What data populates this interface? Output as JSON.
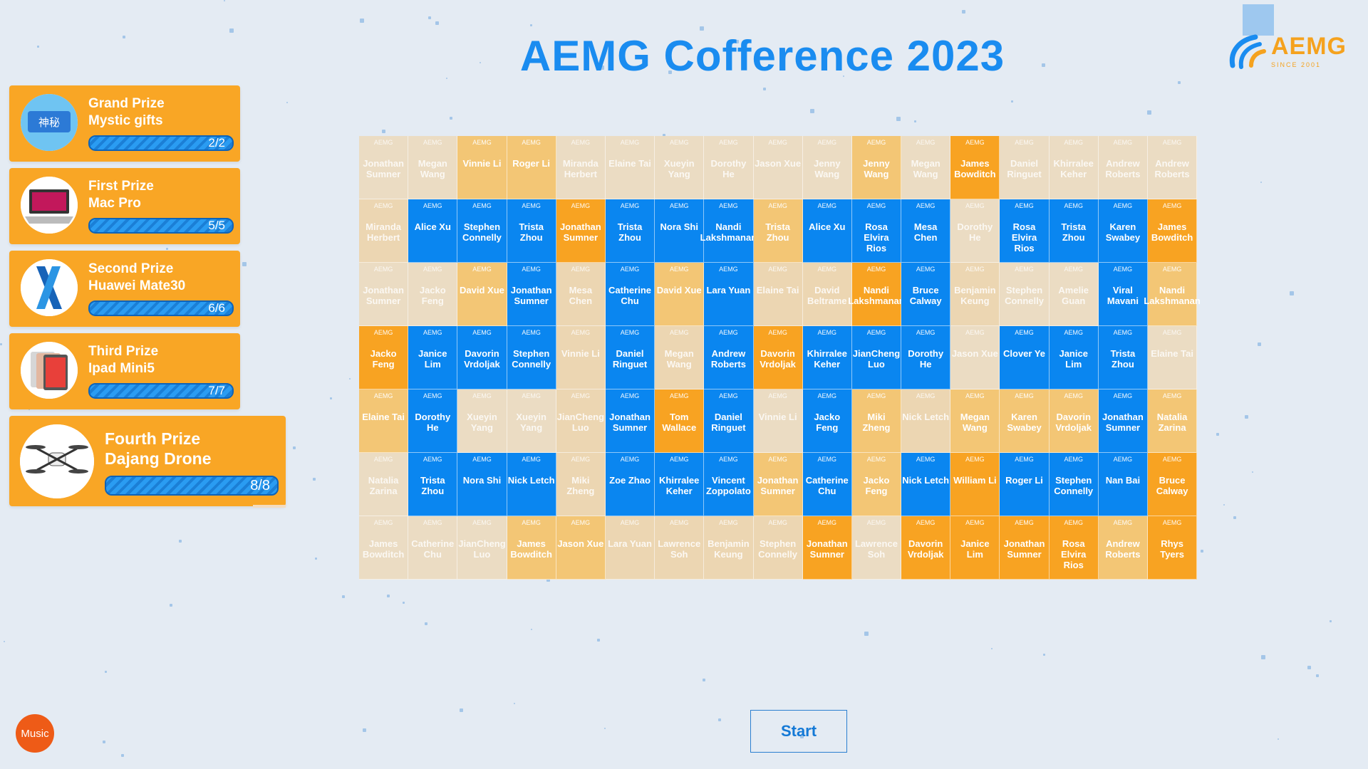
{
  "title": "AEMG Cofference 2023",
  "logo": {
    "text": "AEMG",
    "sub": "SINCE 2001"
  },
  "prizes": [
    {
      "rank": "Grand Prize",
      "item": "Mystic gifts",
      "count": "2/2",
      "icon": "mystery-gift-image"
    },
    {
      "rank": "First Prize",
      "item": "Mac Pro",
      "count": "5/5",
      "icon": "laptop-image"
    },
    {
      "rank": "Second Prize",
      "item": "Huawei Mate30",
      "count": "6/6",
      "icon": "phone-image"
    },
    {
      "rank": "Third Prize",
      "item": "Ipad Mini5",
      "count": "7/7",
      "icon": "tablet-image"
    },
    {
      "rank": "Fourth Prize",
      "item": "Dajang Drone",
      "count": "8/8",
      "icon": "drone-image"
    }
  ],
  "tag": "AEMG",
  "grid": [
    [
      [
        "Jonathan Sumner",
        "light"
      ],
      [
        "Megan Wang",
        "light"
      ],
      [
        "Vinnie Li",
        "tan"
      ],
      [
        "Roger Li",
        "tan"
      ],
      [
        "Miranda Herbert",
        "light"
      ],
      [
        "Elaine Tai",
        "light"
      ],
      [
        "Xueyin Yang",
        "light"
      ],
      [
        "Dorothy He",
        "light"
      ],
      [
        "Jason Xue",
        "light"
      ],
      [
        "Jenny Wang",
        "light"
      ],
      [
        "Jenny Wang",
        "tan"
      ],
      [
        "Megan Wang",
        "light"
      ],
      [
        "James Bowditch",
        "orange"
      ],
      [
        "Daniel Ringuet",
        "light"
      ],
      [
        "Khirralee Keher",
        "light"
      ],
      [
        "Andrew Roberts",
        "light"
      ],
      [
        "Andrew Roberts",
        "light"
      ]
    ],
    [
      [
        "Miranda Herbert",
        "beige"
      ],
      [
        "Alice Xu",
        "blue"
      ],
      [
        "Stephen Connelly",
        "blue"
      ],
      [
        "Trista Zhou",
        "blue"
      ],
      [
        "Jonathan Sumner",
        "orange"
      ],
      [
        "Trista Zhou",
        "blue"
      ],
      [
        "Nora Shi",
        "blue"
      ],
      [
        "Nandi Lakshmanan",
        "blue"
      ],
      [
        "Trista Zhou",
        "tan"
      ],
      [
        "Alice Xu",
        "blue"
      ],
      [
        "Rosa Elvira Rios",
        "blue"
      ],
      [
        "Mesa Chen",
        "blue"
      ],
      [
        "Dorothy He",
        "light"
      ],
      [
        "Rosa Elvira Rios",
        "blue"
      ],
      [
        "Trista Zhou",
        "blue"
      ],
      [
        "Karen Swabey",
        "blue"
      ],
      [
        "James Bowditch",
        "orange"
      ]
    ],
    [
      [
        "Jonathan Sumner",
        "light"
      ],
      [
        "Jacko Feng",
        "light"
      ],
      [
        "David Xue",
        "tan"
      ],
      [
        "Jonathan Sumner",
        "blue"
      ],
      [
        "Mesa Chen",
        "beige"
      ],
      [
        "Catherine Chu",
        "blue"
      ],
      [
        "David Xue",
        "tan"
      ],
      [
        "Lara Yuan",
        "blue"
      ],
      [
        "Elaine Tai",
        "beige"
      ],
      [
        "David Beltrame",
        "beige"
      ],
      [
        "Nandi Lakshmanan",
        "orange"
      ],
      [
        "Bruce Calway",
        "blue"
      ],
      [
        "Benjamin Keung",
        "beige"
      ],
      [
        "Stephen Connelly",
        "light"
      ],
      [
        "Amelie Guan",
        "light"
      ],
      [
        "Viral Mavani",
        "blue"
      ],
      [
        "Nandi Lakshmanan",
        "tan"
      ]
    ],
    [
      [
        "Jacko Feng",
        "orange"
      ],
      [
        "Janice Lim",
        "blue"
      ],
      [
        "Davorin Vrdoljak",
        "blue"
      ],
      [
        "Stephen Connelly",
        "blue"
      ],
      [
        "Vinnie Li",
        "beige"
      ],
      [
        "Daniel Ringuet",
        "blue"
      ],
      [
        "Megan Wang",
        "beige"
      ],
      [
        "Andrew Roberts",
        "blue"
      ],
      [
        "Davorin Vrdoljak",
        "orange"
      ],
      [
        "Khirralee Keher",
        "blue"
      ],
      [
        "JianCheng Luo",
        "blue"
      ],
      [
        "Dorothy He",
        "blue"
      ],
      [
        "Jason Xue",
        "light"
      ],
      [
        "Clover Ye",
        "blue"
      ],
      [
        "Janice Lim",
        "blue"
      ],
      [
        "Trista Zhou",
        "blue"
      ],
      [
        "Elaine Tai",
        "light"
      ]
    ],
    [
      [
        "Elaine Tai",
        "tan"
      ],
      [
        "Dorothy He",
        "blue"
      ],
      [
        "Xueyin Yang",
        "light"
      ],
      [
        "Xueyin Yang",
        "light"
      ],
      [
        "JianCheng Luo",
        "beige"
      ],
      [
        "Jonathan Sumner",
        "blue"
      ],
      [
        "Tom Wallace",
        "orange"
      ],
      [
        "Daniel Ringuet",
        "blue"
      ],
      [
        "Vinnie Li",
        "light"
      ],
      [
        "Jacko Feng",
        "blue"
      ],
      [
        "Miki Zheng",
        "tan"
      ],
      [
        "Nick Letch",
        "beige"
      ],
      [
        "Megan Wang",
        "tan"
      ],
      [
        "Karen Swabey",
        "tan"
      ],
      [
        "Davorin Vrdoljak",
        "tan"
      ],
      [
        "Jonathan Sumner",
        "blue"
      ],
      [
        "Natalia Zarina",
        "tan"
      ]
    ],
    [
      [
        "Natalia Zarina",
        "light"
      ],
      [
        "Trista Zhou",
        "blue"
      ],
      [
        "Nora Shi",
        "blue"
      ],
      [
        "Nick Letch",
        "blue"
      ],
      [
        "Miki Zheng",
        "beige"
      ],
      [
        "Zoe Zhao",
        "blue"
      ],
      [
        "Khirralee Keher",
        "blue"
      ],
      [
        "Vincent Zoppolato",
        "blue"
      ],
      [
        "Jonathan Sumner",
        "tan"
      ],
      [
        "Catherine Chu",
        "blue"
      ],
      [
        "Jacko Feng",
        "tan"
      ],
      [
        "Nick Letch",
        "blue"
      ],
      [
        "William Li",
        "orange"
      ],
      [
        "Roger Li",
        "blue"
      ],
      [
        "Stephen Connelly",
        "blue"
      ],
      [
        "Nan Bai",
        "blue"
      ],
      [
        "Bruce Calway",
        "orange"
      ]
    ],
    [
      [
        "James Bowditch",
        "light"
      ],
      [
        "Catherine Chu",
        "light"
      ],
      [
        "JianCheng Luo",
        "light"
      ],
      [
        "James Bowditch",
        "tan"
      ],
      [
        "Jason Xue",
        "tan"
      ],
      [
        "Lara Yuan",
        "beige"
      ],
      [
        "Lawrence Soh",
        "beige"
      ],
      [
        "Benjamin Keung",
        "beige"
      ],
      [
        "Stephen Connelly",
        "beige"
      ],
      [
        "Jonathan Sumner",
        "orange"
      ],
      [
        "Lawrence Soh",
        "light"
      ],
      [
        "Davorin Vrdoljak",
        "orange"
      ],
      [
        "Janice Lim",
        "orange"
      ],
      [
        "Jonathan Sumner",
        "orange"
      ],
      [
        "Rosa Elvira Rios",
        "orange"
      ],
      [
        "Andrew Roberts",
        "tan"
      ],
      [
        "Rhys Tyers",
        "orange"
      ]
    ]
  ],
  "buttons": {
    "start": "Start",
    "music": "Music"
  }
}
